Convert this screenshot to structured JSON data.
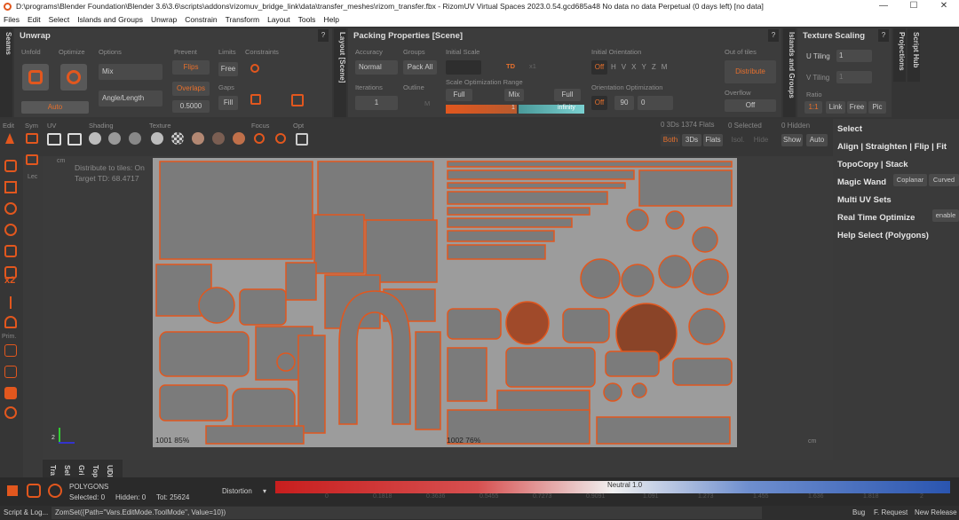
{
  "window": {
    "title": "D:\\programs\\Blender Foundation\\Blender 3.6\\3.6\\scripts\\addons\\rizomuv_bridge_link\\data\\transfer_meshes\\rizom_transfer.fbx - RizomUV  Virtual Spaces 2023.0.54.gcd685a48 No data no data Perpetual  (0 days left) [no data]",
    "minimize": "—",
    "maximize": "☐",
    "close": "✕"
  },
  "menu": [
    "Files",
    "Edit",
    "Select",
    "Islands and Groups",
    "Unwrap",
    "Constrain",
    "Transform",
    "Layout",
    "Tools",
    "Help"
  ],
  "vtabs": {
    "seams": "Seams",
    "layout": "Layout [Scene]",
    "islands": "Islands and Groups",
    "projections": "Projections",
    "script_hub": "Script Hub"
  },
  "unwrap": {
    "title": "Unwrap",
    "help": "?",
    "unfold": "Unfold",
    "optimize": "Optimize",
    "options": "Options",
    "auto": "Auto",
    "mix": "Mix",
    "angle_length": "Angle/Length",
    "prevent": "Prevent",
    "flips": "Flips",
    "overlaps": "Overlaps",
    "prevent_value": "0.5000",
    "limits": "Limits",
    "free": "Free",
    "gaps": "Gaps",
    "fill": "Fill",
    "constraints": "Constraints"
  },
  "packing": {
    "title": "Packing Properties [Scene]",
    "help": "?",
    "accuracy": "Accuracy",
    "normal": "Normal",
    "groups": "Groups",
    "pack_all": "Pack All",
    "iterations": "Iterations",
    "iter_value": "1",
    "outline": "Outline",
    "m": "M",
    "initial_scale": "Initial Scale",
    "td": "TD",
    "x1": "x1",
    "range_label": "Scale Optimization Range",
    "full": "Full",
    "mix": "Mix",
    "range_min": "1",
    "range_max": "infinity",
    "initial_orientation": "Initial Orientation",
    "off": "Off",
    "axes": [
      "H",
      "V",
      "X",
      "Y",
      "Z",
      "M"
    ],
    "orientation_opt": "Orientation Optimization",
    "off2": "Off",
    "deg": "90",
    "zero": "0",
    "out_of_tiles": "Out of tiles",
    "distribute": "Distribute",
    "overflow": "Overflow",
    "overflow_value": "Off"
  },
  "texture_scaling": {
    "title": "Texture Scaling",
    "help": "?",
    "u_tiling": "U Tiling",
    "u_value": "1",
    "v_tiling": "V Tiling",
    "v_value": "1",
    "ratio": "Ratio",
    "ratio_value": "1:1",
    "link": "Link",
    "free": "Free",
    "pic": "Pic"
  },
  "toolbar": {
    "edit": "Edit",
    "sym": "Sym",
    "uv": "UV",
    "shading": "Shading",
    "texture": "Texture",
    "focus": "Focus",
    "opt": "Opt"
  },
  "viewport_info": {
    "counts": "0 3Ds 1374 Flats",
    "selected": "0 Selected",
    "hidden": "0 Hidden",
    "both": "Both",
    "threeds": "3Ds",
    "flats": "Flats",
    "isol": "Isol.",
    "hide": "Hide",
    "show": "Show",
    "auto": "Auto",
    "cm_left": "cm",
    "cm_right": "cm",
    "distribute": "Distribute to tiles: On",
    "target_td": "Target TD: 68.4717",
    "tile1": "1001   85%",
    "tile2": "1002   76%",
    "axis_mark": "2",
    "lec": "Lec",
    "prim": "Prim."
  },
  "right_panel": {
    "select": "Select",
    "align": "Align | Straighten | Flip | Fit",
    "topocopy": "TopoCopy | Stack",
    "magic_wand": "Magic Wand",
    "coplanar": "Coplanar",
    "curved": "Curved",
    "multi_uv": "Multi UV Sets",
    "realtime": "Real Time Optimize",
    "enable": "enable",
    "help_select": "Help Select (Polygons)"
  },
  "left_tools": {
    "x2": "x2"
  },
  "bottom_vtabs": [
    "Tra",
    "Sel",
    "Gri",
    "Top",
    "UDI"
  ],
  "status": {
    "mode": "POLYGONS",
    "selected": "Selected: 0",
    "hidden": "Hidden: 0",
    "tot": "Tot: 25624",
    "distortion": "Distortion",
    "neutral": "Neutral 1.0",
    "ticks": [
      "0",
      "0.1818",
      "0.3636",
      "0.5455",
      "0.7273",
      "0.9091",
      "1.091",
      "1.273",
      "1.455",
      "1.636",
      "1.818",
      "2"
    ]
  },
  "footer": {
    "script": "Script & Log...",
    "command": "ZomSet({Path=\"Vars.EditMode.ToolMode\", Value=10})",
    "bug": "Bug",
    "feature": "F. Request",
    "release": "New Release"
  },
  "colors": {
    "accent": "#e2571e",
    "uv_fill": "#7d7d7d",
    "uv_bg": "#9a9a9a"
  }
}
